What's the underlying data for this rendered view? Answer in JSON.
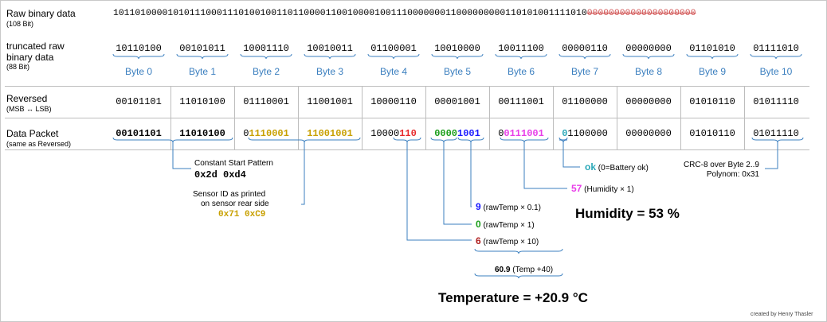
{
  "labels": {
    "raw_title": "Raw binary data",
    "raw_sub": "(108 Bit)",
    "trunc_title_1": "truncated raw",
    "trunc_title_2": "binary data",
    "trunc_sub": "(88 Bit)",
    "rev_title": "Reversed",
    "rev_sub": "(MSB ↔ LSB)",
    "packet_title": "Data Packet",
    "packet_sub": "(same as Reversed)"
  },
  "raw_bits": {
    "kept": "1011010000101011100011101001001101100001100100001001110000000110000000001101010011110",
    "tail": "10",
    "struck": "00000000000000000000"
  },
  "bytes": [
    {
      "name": "Byte 0",
      "truncated": "10110100",
      "reversed": "00101101"
    },
    {
      "name": "Byte 1",
      "truncated": "00101011",
      "reversed": "11010100"
    },
    {
      "name": "Byte 2",
      "truncated": "10001110",
      "reversed": "01110001"
    },
    {
      "name": "Byte 3",
      "truncated": "10010011",
      "reversed": "11001001"
    },
    {
      "name": "Byte 4",
      "truncated": "01100001",
      "reversed": "10000110"
    },
    {
      "name": "Byte 5",
      "truncated": "10010000",
      "reversed": "00001001"
    },
    {
      "name": "Byte 6",
      "truncated": "10011100",
      "reversed": "00111001"
    },
    {
      "name": "Byte 7",
      "truncated": "00000110",
      "reversed": "01100000"
    },
    {
      "name": "Byte 8",
      "truncated": "00000000",
      "reversed": "00000000"
    },
    {
      "name": "Byte 9",
      "truncated": "01101010",
      "reversed": "01010110"
    },
    {
      "name": "Byte 10",
      "truncated": "01111010",
      "reversed": "01011110"
    }
  ],
  "packet": [
    [
      {
        "t": "00101101",
        "c": "#000000",
        "b": true
      }
    ],
    [
      {
        "t": "11010100",
        "c": "#000000",
        "b": true
      }
    ],
    [
      {
        "t": "0",
        "c": "#000000",
        "b": false
      },
      {
        "t": "1110001",
        "c": "#c8a000",
        "b": true
      }
    ],
    [
      {
        "t": "11001001",
        "c": "#c8a000",
        "b": true
      }
    ],
    [
      {
        "t": "10000",
        "c": "#000000",
        "b": false
      },
      {
        "t": "110",
        "c": "#e8292b",
        "b": true
      }
    ],
    [
      {
        "t": "0000",
        "c": "#1a9e1a",
        "b": true
      },
      {
        "t": "1001",
        "c": "#1a1aff",
        "b": true
      }
    ],
    [
      {
        "t": "0",
        "c": "#000000",
        "b": false
      },
      {
        "t": "0111001",
        "c": "#e83ee8",
        "b": true
      }
    ],
    [
      {
        "t": "0",
        "c": "#2aa8b8",
        "b": true
      },
      {
        "t": "1100000",
        "c": "#000000",
        "b": false
      }
    ],
    [
      {
        "t": "00000000",
        "c": "#000000",
        "b": false
      }
    ],
    [
      {
        "t": "01010110",
        "c": "#000000",
        "b": false
      }
    ],
    [
      {
        "t": "01011110",
        "c": "#000000",
        "b": false
      }
    ]
  ],
  "annotations": {
    "start_title": "Constant Start Pattern",
    "start_value": "0x2d 0xd4",
    "sensor_1": "Sensor ID as printed",
    "sensor_2": "on sensor rear side",
    "sensor_value": "0x71 0xC9",
    "battery_value": "ok",
    "battery_note": "(0=Battery ok)",
    "crc_1": "CRC-8 over Byte 2..9",
    "crc_2": "Polynom: 0x31",
    "humidity_value": "57",
    "humidity_note": "(Humidity × 1)",
    "humidity_result": "Humidity = 53 %",
    "temp_a_value": "9",
    "temp_a_note": "(rawTemp × 0.1)",
    "temp_b_value": "0",
    "temp_b_note": "(rawTemp × 1)",
    "temp_c_value": "6",
    "temp_c_note": "(rawTemp × 10)",
    "temp_sum_value": "60.9",
    "temp_sum_note": "(Temp +40)",
    "temp_result": "Temperature = +20.9 °C",
    "credit": "created by Henry Thasler"
  },
  "colors": {
    "byte_name": "#3b7fbf",
    "brace": "#3b7fbf",
    "yellow": "#c8a000",
    "red": "#e8292b",
    "green": "#1a9e1a",
    "blue": "#1a1aff",
    "magenta": "#e83ee8",
    "cyan": "#2aa8b8",
    "struck": "#d05050"
  }
}
